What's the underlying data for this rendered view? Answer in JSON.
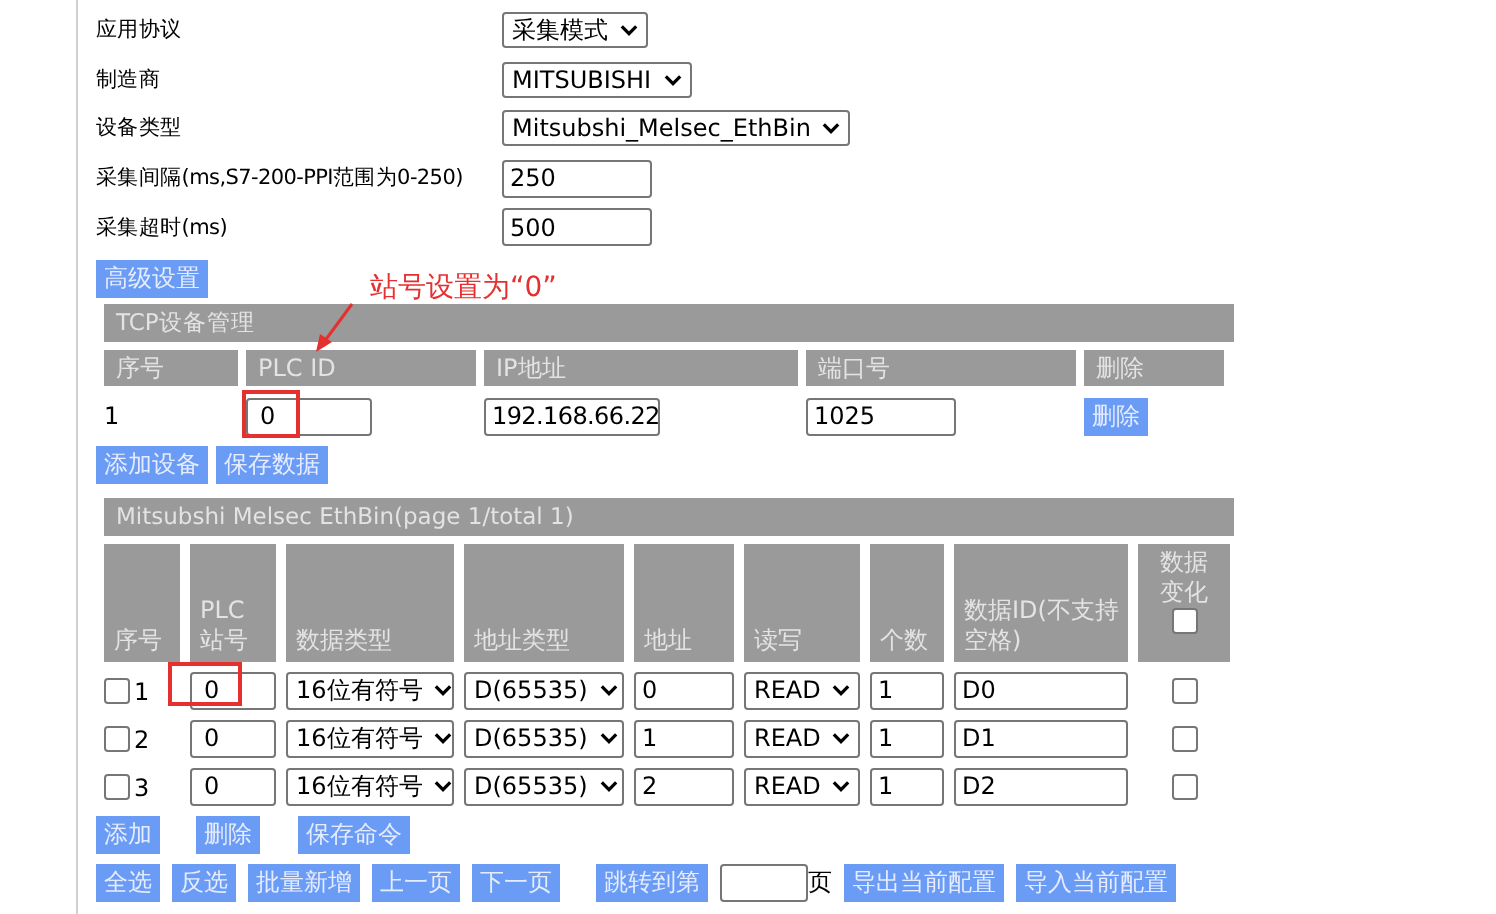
{
  "form": [
    {
      "label": "应用协议",
      "kind": "select",
      "value": "采集模式"
    },
    {
      "label": "制造商",
      "kind": "select",
      "value": "MITSUBISHI"
    },
    {
      "label": "设备类型",
      "kind": "select",
      "value": "Mitsubshi_Melsec_EthBin"
    },
    {
      "label": "采集间隔(ms,S7-200-PPI范围为0-250)",
      "kind": "input",
      "value": "250"
    },
    {
      "label": "采集超时(ms)",
      "kind": "input",
      "value": "500"
    }
  ],
  "advanced_button": "高级设置",
  "annotation": {
    "text": "站号设置为“0”"
  },
  "tcp": {
    "title": "TCP设备管理",
    "columns": [
      "序号",
      "PLC ID",
      "IP地址",
      "端口号",
      "删除"
    ],
    "rows": [
      {
        "index": "1",
        "plc_id": "0",
        "ip": "192.168.66.22",
        "port": "1025",
        "delete": "删除"
      }
    ],
    "buttons": [
      "添加设备",
      "保存数据"
    ]
  },
  "points": {
    "title": "Mitsubshi Melsec EthBin(page 1/total 1)",
    "columns": [
      "序号",
      "PLC 站号",
      "数据类型",
      "地址类型",
      "地址",
      "读写",
      "个数",
      "数据ID(不支持空格)",
      "数据变化"
    ],
    "change_all_checked": false,
    "rows": [
      {
        "checked": false,
        "index": "1",
        "plc": "0",
        "data_type": "16位有符号",
        "addr_type": "D(65535)",
        "addr": "0",
        "rw": "READ",
        "count": "1",
        "data_id": "D0",
        "change": false
      },
      {
        "checked": false,
        "index": "2",
        "plc": "0",
        "data_type": "16位有符号",
        "addr_type": "D(65535)",
        "addr": "1",
        "rw": "READ",
        "count": "1",
        "data_id": "D1",
        "change": false
      },
      {
        "checked": false,
        "index": "3",
        "plc": "0",
        "data_type": "16位有符号",
        "addr_type": "D(65535)",
        "addr": "2",
        "rw": "READ",
        "count": "1",
        "data_id": "D2",
        "change": false
      }
    ],
    "command_buttons": [
      "添加",
      "删除",
      "保存命令"
    ],
    "page_buttons": [
      "全选",
      "反选",
      "批量新增",
      "上一页",
      "下一页"
    ],
    "jump_button": "跳转到第",
    "page_unit": "页",
    "config_buttons": [
      "导出当前配置",
      "导入当前配置"
    ]
  }
}
